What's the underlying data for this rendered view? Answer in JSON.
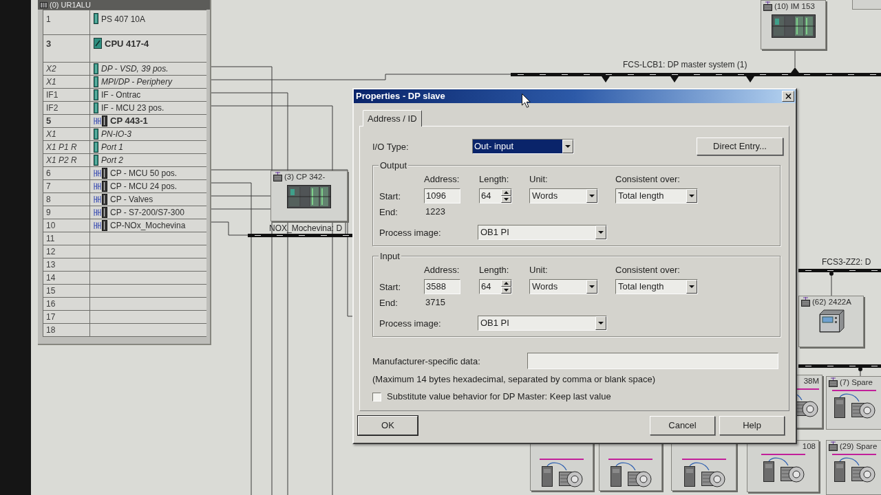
{
  "rack": {
    "title": "(0) UR1ALU",
    "rows": [
      {
        "slot": "1",
        "module": "PS 407 10A",
        "kind": "power"
      },
      {
        "slot": "3",
        "module": "CPU 417-4",
        "kind": "cpu"
      },
      {
        "slot": "X2",
        "module": "DP - VSD, 39 pos.",
        "kind": "interface"
      },
      {
        "slot": "X1",
        "module": "MPI/DP - Periphery",
        "kind": "interface"
      },
      {
        "slot": "IF1",
        "module": "IF - Ontrac",
        "kind": "submodule"
      },
      {
        "slot": "IF2",
        "module": "IF - MCU 23 pos.",
        "kind": "submodule"
      },
      {
        "slot": "5",
        "module": "CP 443-1",
        "kind": "cp_main"
      },
      {
        "slot": "X1",
        "module": "PN-IO-3",
        "kind": "interface"
      },
      {
        "slot": "X1 P1 R",
        "module": "Port 1",
        "kind": "interface"
      },
      {
        "slot": "X1 P2 R",
        "module": "Port 2",
        "kind": "interface"
      },
      {
        "slot": "6",
        "module": "CP - MCU 50 pos.",
        "kind": "cp"
      },
      {
        "slot": "7",
        "module": "CP - MCU 24 pos.",
        "kind": "cp"
      },
      {
        "slot": "8",
        "module": "CP - Valves",
        "kind": "cp"
      },
      {
        "slot": "9",
        "module": "CP - S7-200/S7-300",
        "kind": "cp"
      },
      {
        "slot": "10",
        "module": "CP-NOx_Mochevina",
        "kind": "cp"
      },
      {
        "slot": "11",
        "kind": "empty"
      },
      {
        "slot": "12",
        "kind": "empty"
      },
      {
        "slot": "13",
        "kind": "empty"
      },
      {
        "slot": "14",
        "kind": "empty"
      },
      {
        "slot": "15",
        "kind": "empty"
      },
      {
        "slot": "16",
        "kind": "empty"
      },
      {
        "slot": "17",
        "kind": "empty"
      },
      {
        "slot": "18",
        "kind": "empty"
      }
    ]
  },
  "network": {
    "buses": [
      {
        "kind": "dp",
        "label": "FCS-LCB1: DP master system (1)"
      },
      {
        "kind": "dp",
        "label": "NOX_Mochevina: D"
      },
      {
        "kind": "dp",
        "label": "FCS3-ZZ2: D"
      },
      {
        "kind": "dp"
      }
    ],
    "nodes": [
      {
        "kind": "rack",
        "label": "(10) IM 153"
      },
      {
        "kind": "blank"
      },
      {
        "kind": "rack",
        "label": "(3) CP 342-"
      },
      {
        "kind": "panel",
        "label": "(62) 2422A"
      },
      {
        "kind": "drive",
        "label": "38M"
      },
      {
        "kind": "drive",
        "label": "(7) Spare"
      },
      {
        "kind": "drive"
      },
      {
        "kind": "drive"
      },
      {
        "kind": "drive"
      },
      {
        "kind": "drive",
        "label": "108"
      },
      {
        "kind": "drive",
        "label": "(29) Spare"
      }
    ]
  },
  "dialog": {
    "title": "Properties - DP slave",
    "tabs": [
      {
        "label": "Address / ID",
        "selected": true
      }
    ],
    "io_type": {
      "label": "I/O Type:",
      "value": "Out- input",
      "highlighted": true
    },
    "direct_entry_button": "Direct Entry...",
    "groups": [
      {
        "title": "Output",
        "address_header": "Address:",
        "length_header": "Length:",
        "unit_header": "Unit:",
        "consistent_header": "Consistent over:",
        "start_label": "Start:",
        "start": "1096",
        "length": "64",
        "unit": "Words",
        "consistent_over": "Total length",
        "end_label": "End:",
        "end": "1223",
        "process_image_label": "Process image:",
        "process_image": "OB1 PI"
      },
      {
        "title": "Input",
        "address_header": "Address:",
        "length_header": "Length:",
        "unit_header": "Unit:",
        "consistent_header": "Consistent over:",
        "start_label": "Start:",
        "start": "3588",
        "length": "64",
        "unit": "Words",
        "consistent_over": "Total length",
        "end_label": "End:",
        "end": "3715",
        "process_image_label": "Process image:",
        "process_image": "OB1 PI"
      }
    ],
    "manufacturer_data": {
      "label": "Manufacturer-specific data:",
      "hint": "(Maximum 14 bytes hexadecimal, separated by comma or blank space)"
    },
    "substitute_checkbox": {
      "label": "Substitute value behavior for DP Master: Keep last value",
      "checked": false
    },
    "buttons": [
      "OK",
      "Cancel",
      "Help"
    ]
  }
}
